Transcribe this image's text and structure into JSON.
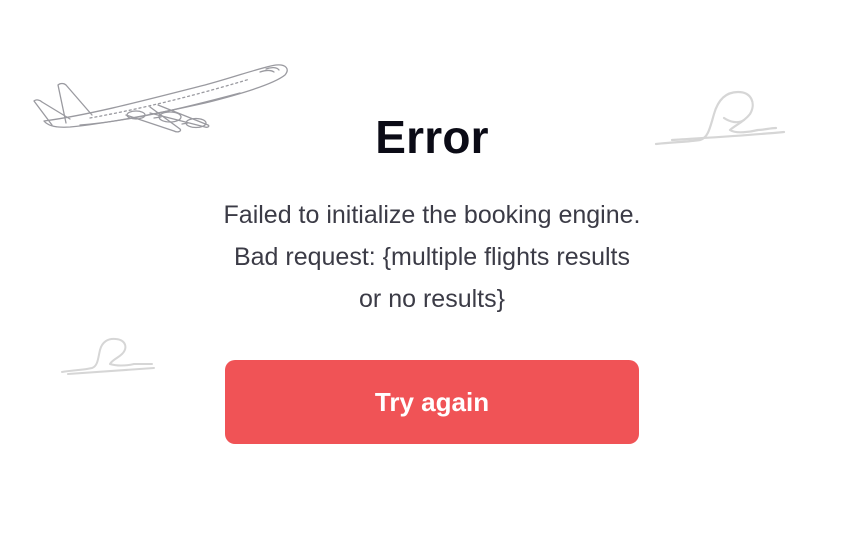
{
  "error": {
    "title": "Error",
    "message": "Failed to initialize the booking engine. Bad request: {multiple flights results or no results}",
    "retry_label": "Try again"
  },
  "decorations": {
    "plane_icon": "airplane-illustration",
    "cloud_icon": "cloud-squiggle",
    "line_color": "#9a9aa0",
    "cloud_color": "#d6d6d6"
  },
  "colors": {
    "accent": "#f05356",
    "title": "#0b0b16",
    "text": "#3b3b46",
    "background": "#ffffff"
  }
}
